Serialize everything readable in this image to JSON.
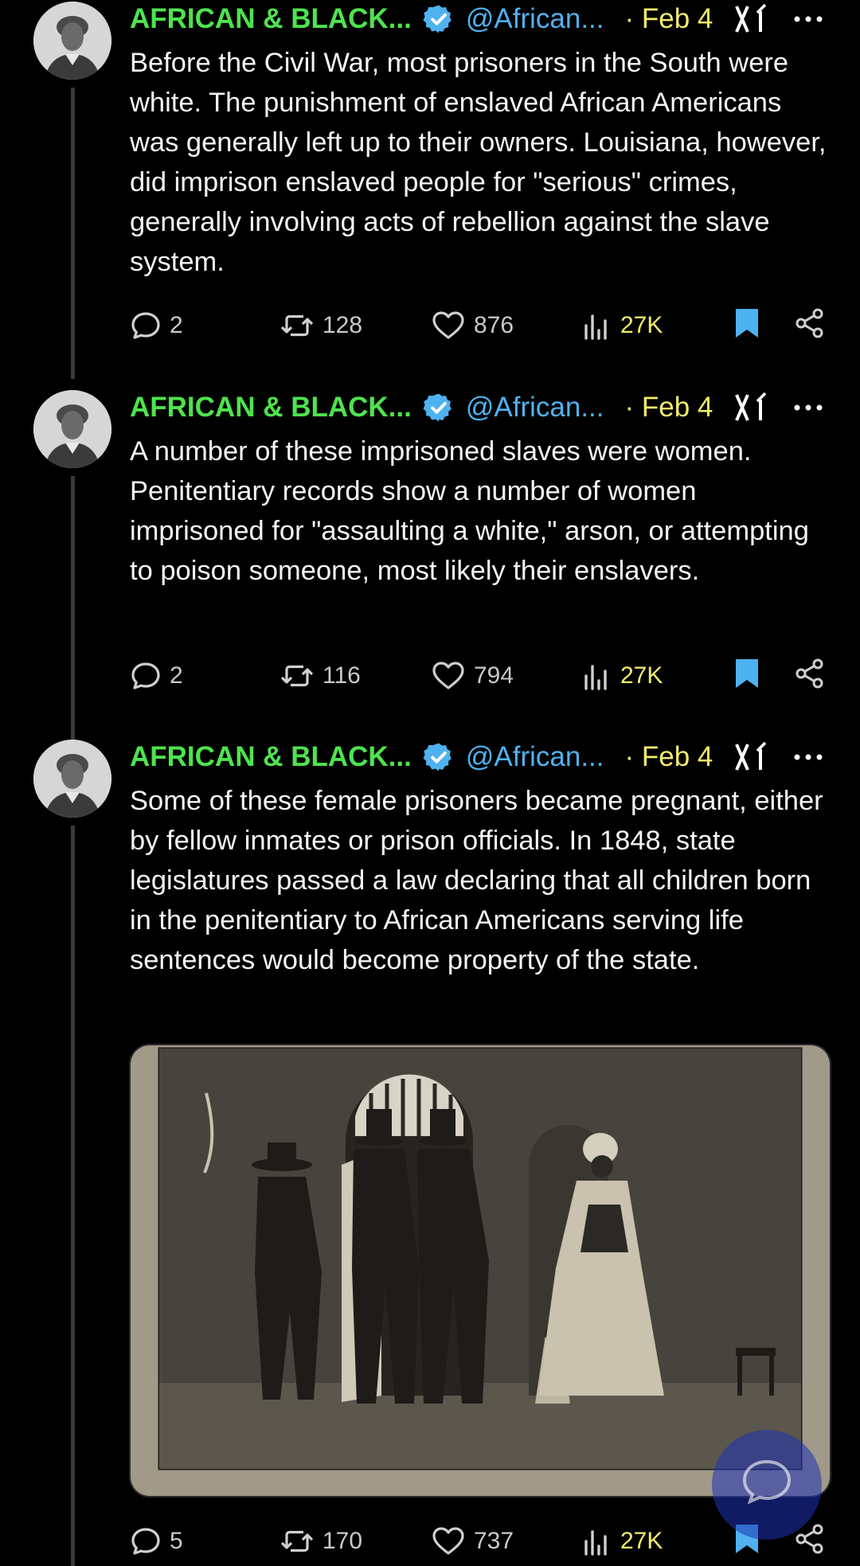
{
  "tweets": [
    {
      "display_name": "AFRICAN & BLACK...",
      "handle": "@African...",
      "date": "· Feb 4",
      "text": "Before the Civil War, most prisoners in the South were white. The punishment of enslaved African Americans was generally left up to their owners. Louisiana, however, did imprison enslaved people for \"serious\" crimes, generally involving acts of rebellion against the slave system.",
      "replies": "2",
      "reposts": "128",
      "likes": "876",
      "views": "27K"
    },
    {
      "display_name": "AFRICAN & BLACK...",
      "handle": "@African...",
      "date": "· Feb 4",
      "text": "A number of these imprisoned slaves were women. Penitentiary records show a number of women imprisoned for \"assaulting a white,\" arson, or attempting to poison someone, most likely their enslavers.",
      "replies": "2",
      "reposts": "116",
      "likes": "794",
      "views": "27K"
    },
    {
      "display_name": "AFRICAN & BLACK...",
      "handle": "@African...",
      "date": "· Feb 4",
      "text": "Some of these female prisoners became pregnant, either by fellow inmates or prison officials. In 1848, state legislatures passed a law declaring that all children born in the penitentiary to African Americans serving life sentences would become property of the state.",
      "replies": "5",
      "reposts": "170",
      "likes": "737",
      "views": "27K"
    }
  ],
  "colors": {
    "name": "#4ee34e",
    "handle": "#4fb2f0",
    "date": "#f3ed6a",
    "verified": "#4fb2f0",
    "bookmark": "#4fb2f0",
    "views": "#f3ed6a",
    "background": "#000000"
  },
  "icons": {
    "reply": "speech-bubble-icon",
    "repost": "repost-arrows-icon",
    "like": "heart-icon",
    "views": "bar-chart-icon",
    "bookmark": "bookmark-icon",
    "share": "share-icon",
    "grok": "grok-xi-icon",
    "more": "more-dots-icon",
    "compose": "compose-reply-icon"
  }
}
